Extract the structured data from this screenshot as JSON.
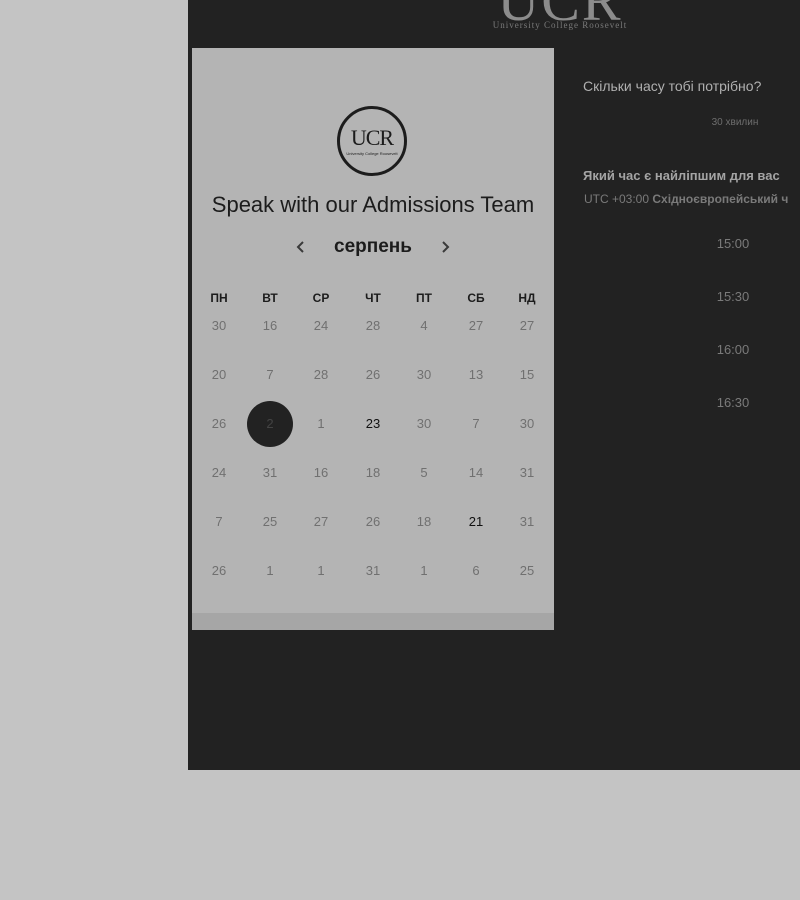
{
  "brand": {
    "logo_text": "UCR",
    "logo_subtext": "University College Roosevelt"
  },
  "calendar": {
    "title": "Speak with our Admissions Team",
    "month": "серпень",
    "prev_icon": "chevron-left-icon",
    "next_icon": "chevron-right-icon",
    "weekdays": [
      "ПН",
      "ВТ",
      "СР",
      "ЧТ",
      "ПТ",
      "СБ",
      "НД"
    ],
    "weeks": [
      [
        "30",
        "16",
        "24",
        "28",
        "4",
        "27",
        "27"
      ],
      [
        "20",
        "7",
        "28",
        "26",
        "30",
        "13",
        "15"
      ],
      [
        "26",
        "2",
        "1",
        "23",
        "30",
        "7",
        "30"
      ],
      [
        "24",
        "31",
        "16",
        "18",
        "5",
        "14",
        "31"
      ],
      [
        "7",
        "25",
        "27",
        "26",
        "18",
        "21",
        "31"
      ],
      [
        "26",
        "1",
        "1",
        "31",
        "1",
        "6",
        "25"
      ]
    ],
    "selected_day": "2",
    "available_days": [
      "23",
      "21"
    ]
  },
  "booking": {
    "duration_question": "Скільки часу тобі потрібно?",
    "duration_value": "30 хвилин",
    "time_question": "Який час є найліпшим для вас",
    "timezone_offset": "UTC +03:00",
    "timezone_name": "Східноєвропейський ч",
    "slots": [
      "15:00",
      "15:30",
      "16:00",
      "16:30"
    ]
  },
  "colors": {
    "page_background": "#c4c4c4",
    "dark_panel": "#222222",
    "calendar_card": "#b4b4b4",
    "selected_day": "#222222"
  }
}
